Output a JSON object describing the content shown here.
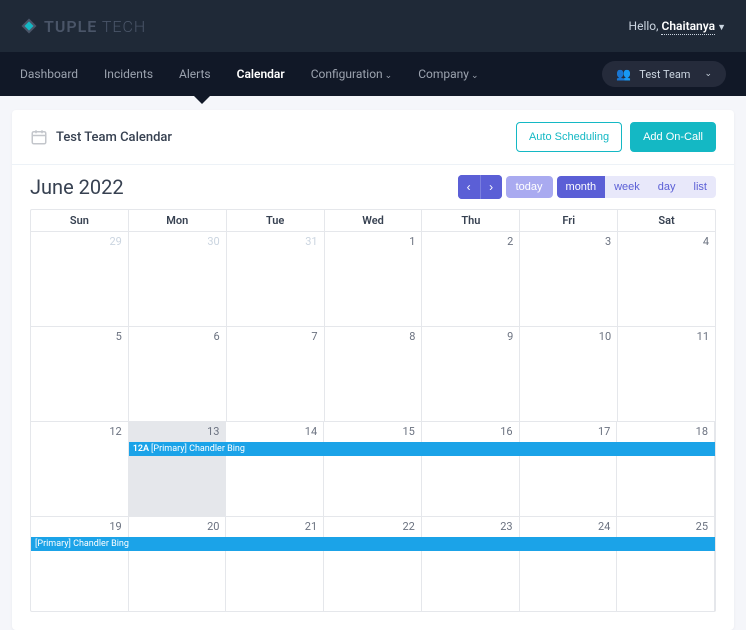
{
  "brand": {
    "tuple": "TUPLE",
    "tech": " TECH"
  },
  "greeting": {
    "hello": "Hello, ",
    "username": "Chaitanya"
  },
  "nav": {
    "items": [
      {
        "label": "Dashboard",
        "dropdown": false
      },
      {
        "label": "Incidents",
        "dropdown": false
      },
      {
        "label": "Alerts",
        "dropdown": false
      },
      {
        "label": "Calendar",
        "dropdown": false
      },
      {
        "label": "Configuration",
        "dropdown": true
      },
      {
        "label": "Company",
        "dropdown": true
      }
    ],
    "active_index": 3
  },
  "team_selector": {
    "label": "Test Team"
  },
  "page": {
    "title": "Test Team Calendar",
    "auto_scheduling": "Auto Scheduling",
    "add_on_call": "Add On-Call"
  },
  "calendar": {
    "title": "June 2022",
    "today_label": "today",
    "views": [
      "month",
      "week",
      "day",
      "list"
    ],
    "active_view": "month",
    "day_headers": [
      "Sun",
      "Mon",
      "Tue",
      "Wed",
      "Thu",
      "Fri",
      "Sat"
    ],
    "weeks": [
      {
        "days": [
          {
            "n": "29",
            "other": true
          },
          {
            "n": "30",
            "other": true
          },
          {
            "n": "31",
            "other": true
          },
          {
            "n": "1"
          },
          {
            "n": "2"
          },
          {
            "n": "3"
          },
          {
            "n": "4"
          }
        ],
        "event": null
      },
      {
        "days": [
          {
            "n": "5"
          },
          {
            "n": "6"
          },
          {
            "n": "7"
          },
          {
            "n": "8"
          },
          {
            "n": "9"
          },
          {
            "n": "10"
          },
          {
            "n": "11"
          }
        ],
        "event": null
      },
      {
        "days": [
          {
            "n": "12"
          },
          {
            "n": "13",
            "today": true
          },
          {
            "n": "14"
          },
          {
            "n": "15"
          },
          {
            "n": "16"
          },
          {
            "n": "17"
          },
          {
            "n": "18"
          }
        ],
        "event": {
          "time": "12A",
          "label": "[Primary] Chandler Bing",
          "offset": true
        }
      },
      {
        "days": [
          {
            "n": "19"
          },
          {
            "n": "20"
          },
          {
            "n": "21"
          },
          {
            "n": "22"
          },
          {
            "n": "23"
          },
          {
            "n": "24"
          },
          {
            "n": "25"
          }
        ],
        "event": {
          "time": "",
          "label": "[Primary] Chandler Bing",
          "offset": false
        }
      }
    ]
  }
}
